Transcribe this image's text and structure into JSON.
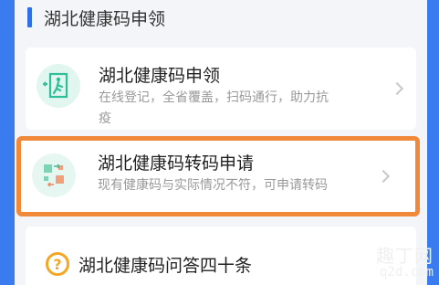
{
  "section": {
    "title": "湖北健康码申领"
  },
  "items": [
    {
      "title": "湖北健康码申领",
      "desc_line1": "在线登记，全省覆盖，扫码通行，助力抗",
      "desc_line2": "疫",
      "icon": "door-exit-icon"
    },
    {
      "title": "湖北健康码转码申请",
      "desc_line1": "现有健康码与实际情况不符，可申请转码",
      "icon": "qr-convert-icon"
    }
  ],
  "faq": {
    "icon": "question-icon",
    "icon_glyph": "?",
    "title": "湖北健康码问答四十条"
  },
  "watermark": {
    "text": "趣丁网",
    "url": "q2d.com"
  },
  "colors": {
    "background": "#3a7bf0",
    "highlight": "#f0893a",
    "accent": "#2f6fe8"
  }
}
